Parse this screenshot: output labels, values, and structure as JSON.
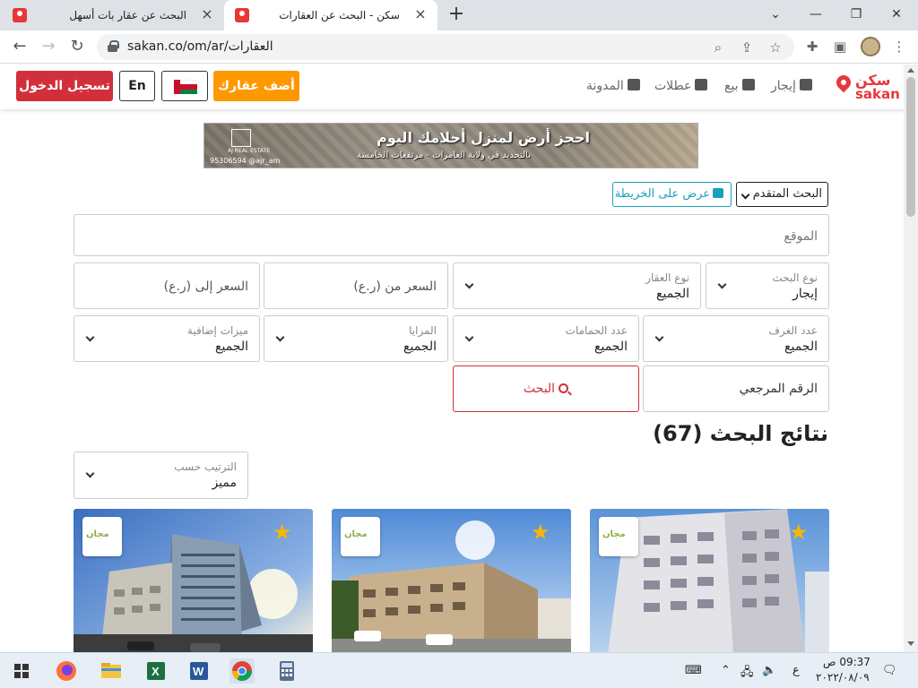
{
  "browser": {
    "tabs": [
      {
        "title": "البحث عن عقار بات أسهل",
        "active": false
      },
      {
        "title": "سكن - البحث عن العقارات",
        "active": true
      }
    ],
    "url": "sakan.co/om/ar/العقارات"
  },
  "header": {
    "logo_ar": "سكن",
    "logo_en": "sakan",
    "nav": [
      {
        "label": "إيجار"
      },
      {
        "label": "بيع"
      },
      {
        "label": "عطلات"
      },
      {
        "label": "المدونة"
      }
    ],
    "add_property": "أضف عقارك",
    "lang": "En",
    "login": "تسجيل الدخول"
  },
  "banner": {
    "title": "احجز أرض لمنزل أحلامك اليوم",
    "subtitle": "بالتحديد في ولاية العامرات - مرتفعات الخامسة",
    "contact": "95306594 @ajr_am",
    "logo_text": "AJ REAL ESTATE"
  },
  "search": {
    "advanced": "البحث المتقدم",
    "map": "عرض على الخريطة",
    "location_placeholder": "الموقع",
    "search_type": {
      "label": "نوع البحث",
      "value": "إيجار"
    },
    "property_type": {
      "label": "نوع العقار",
      "value": "الجميع"
    },
    "price_from": "السعر من (ر.ع)",
    "price_to": "السعر إلى (ر.ع)",
    "rooms": {
      "label": "عدد الغرف",
      "value": "الجميع"
    },
    "baths": {
      "label": "عدد الحمامات",
      "value": "الجميع"
    },
    "features": {
      "label": "المزايا",
      "value": "الجميع"
    },
    "extras": {
      "label": "ميزات إضافية",
      "value": "الجميع"
    },
    "reference": "الرقم المرجعي",
    "button": "البحث"
  },
  "results": {
    "title": "نتائج البحث (67)",
    "sort": {
      "label": "الترتيب حسب",
      "value": "مميز"
    },
    "cards": [
      {
        "agency": "مجان",
        "favorite": true
      },
      {
        "agency": "مجان",
        "favorite": true
      },
      {
        "agency": "مجان",
        "favorite": true
      }
    ]
  },
  "taskbar": {
    "time": "09:37 ص",
    "date": "٢٠٢٢/٠٨/٠٩",
    "lang": "ع"
  },
  "colors": {
    "brand_red": "#e5393c",
    "login_red": "#d32f3a",
    "add_orange": "#ff9800",
    "map_teal": "#17a2b8",
    "star": "#f5b800"
  }
}
